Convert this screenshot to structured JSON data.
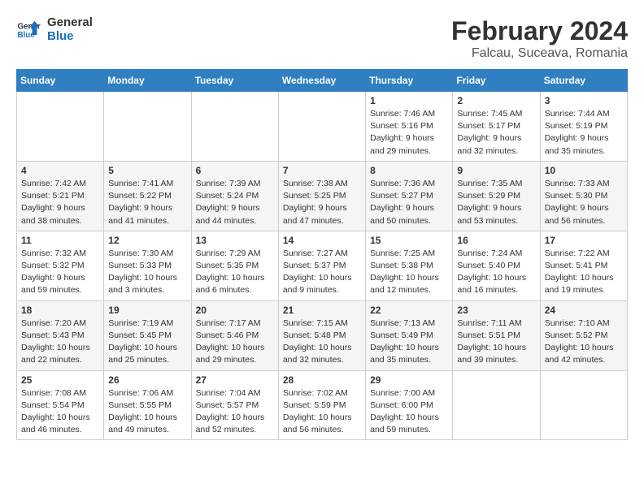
{
  "header": {
    "logo_line1": "General",
    "logo_line2": "Blue",
    "title": "February 2024",
    "subtitle": "Falcau, Suceava, Romania"
  },
  "weekdays": [
    "Sunday",
    "Monday",
    "Tuesday",
    "Wednesday",
    "Thursday",
    "Friday",
    "Saturday"
  ],
  "weeks": [
    [
      {
        "day": "",
        "sunrise": "",
        "sunset": "",
        "daylight": ""
      },
      {
        "day": "",
        "sunrise": "",
        "sunset": "",
        "daylight": ""
      },
      {
        "day": "",
        "sunrise": "",
        "sunset": "",
        "daylight": ""
      },
      {
        "day": "",
        "sunrise": "",
        "sunset": "",
        "daylight": ""
      },
      {
        "day": "1",
        "sunrise": "Sunrise: 7:46 AM",
        "sunset": "Sunset: 5:16 PM",
        "daylight": "Daylight: 9 hours and 29 minutes."
      },
      {
        "day": "2",
        "sunrise": "Sunrise: 7:45 AM",
        "sunset": "Sunset: 5:17 PM",
        "daylight": "Daylight: 9 hours and 32 minutes."
      },
      {
        "day": "3",
        "sunrise": "Sunrise: 7:44 AM",
        "sunset": "Sunset: 5:19 PM",
        "daylight": "Daylight: 9 hours and 35 minutes."
      }
    ],
    [
      {
        "day": "4",
        "sunrise": "Sunrise: 7:42 AM",
        "sunset": "Sunset: 5:21 PM",
        "daylight": "Daylight: 9 hours and 38 minutes."
      },
      {
        "day": "5",
        "sunrise": "Sunrise: 7:41 AM",
        "sunset": "Sunset: 5:22 PM",
        "daylight": "Daylight: 9 hours and 41 minutes."
      },
      {
        "day": "6",
        "sunrise": "Sunrise: 7:39 AM",
        "sunset": "Sunset: 5:24 PM",
        "daylight": "Daylight: 9 hours and 44 minutes."
      },
      {
        "day": "7",
        "sunrise": "Sunrise: 7:38 AM",
        "sunset": "Sunset: 5:25 PM",
        "daylight": "Daylight: 9 hours and 47 minutes."
      },
      {
        "day": "8",
        "sunrise": "Sunrise: 7:36 AM",
        "sunset": "Sunset: 5:27 PM",
        "daylight": "Daylight: 9 hours and 50 minutes."
      },
      {
        "day": "9",
        "sunrise": "Sunrise: 7:35 AM",
        "sunset": "Sunset: 5:29 PM",
        "daylight": "Daylight: 9 hours and 53 minutes."
      },
      {
        "day": "10",
        "sunrise": "Sunrise: 7:33 AM",
        "sunset": "Sunset: 5:30 PM",
        "daylight": "Daylight: 9 hours and 56 minutes."
      }
    ],
    [
      {
        "day": "11",
        "sunrise": "Sunrise: 7:32 AM",
        "sunset": "Sunset: 5:32 PM",
        "daylight": "Daylight: 9 hours and 59 minutes."
      },
      {
        "day": "12",
        "sunrise": "Sunrise: 7:30 AM",
        "sunset": "Sunset: 5:33 PM",
        "daylight": "Daylight: 10 hours and 3 minutes."
      },
      {
        "day": "13",
        "sunrise": "Sunrise: 7:29 AM",
        "sunset": "Sunset: 5:35 PM",
        "daylight": "Daylight: 10 hours and 6 minutes."
      },
      {
        "day": "14",
        "sunrise": "Sunrise: 7:27 AM",
        "sunset": "Sunset: 5:37 PM",
        "daylight": "Daylight: 10 hours and 9 minutes."
      },
      {
        "day": "15",
        "sunrise": "Sunrise: 7:25 AM",
        "sunset": "Sunset: 5:38 PM",
        "daylight": "Daylight: 10 hours and 12 minutes."
      },
      {
        "day": "16",
        "sunrise": "Sunrise: 7:24 AM",
        "sunset": "Sunset: 5:40 PM",
        "daylight": "Daylight: 10 hours and 16 minutes."
      },
      {
        "day": "17",
        "sunrise": "Sunrise: 7:22 AM",
        "sunset": "Sunset: 5:41 PM",
        "daylight": "Daylight: 10 hours and 19 minutes."
      }
    ],
    [
      {
        "day": "18",
        "sunrise": "Sunrise: 7:20 AM",
        "sunset": "Sunset: 5:43 PM",
        "daylight": "Daylight: 10 hours and 22 minutes."
      },
      {
        "day": "19",
        "sunrise": "Sunrise: 7:19 AM",
        "sunset": "Sunset: 5:45 PM",
        "daylight": "Daylight: 10 hours and 25 minutes."
      },
      {
        "day": "20",
        "sunrise": "Sunrise: 7:17 AM",
        "sunset": "Sunset: 5:46 PM",
        "daylight": "Daylight: 10 hours and 29 minutes."
      },
      {
        "day": "21",
        "sunrise": "Sunrise: 7:15 AM",
        "sunset": "Sunset: 5:48 PM",
        "daylight": "Daylight: 10 hours and 32 minutes."
      },
      {
        "day": "22",
        "sunrise": "Sunrise: 7:13 AM",
        "sunset": "Sunset: 5:49 PM",
        "daylight": "Daylight: 10 hours and 35 minutes."
      },
      {
        "day": "23",
        "sunrise": "Sunrise: 7:11 AM",
        "sunset": "Sunset: 5:51 PM",
        "daylight": "Daylight: 10 hours and 39 minutes."
      },
      {
        "day": "24",
        "sunrise": "Sunrise: 7:10 AM",
        "sunset": "Sunset: 5:52 PM",
        "daylight": "Daylight: 10 hours and 42 minutes."
      }
    ],
    [
      {
        "day": "25",
        "sunrise": "Sunrise: 7:08 AM",
        "sunset": "Sunset: 5:54 PM",
        "daylight": "Daylight: 10 hours and 46 minutes."
      },
      {
        "day": "26",
        "sunrise": "Sunrise: 7:06 AM",
        "sunset": "Sunset: 5:55 PM",
        "daylight": "Daylight: 10 hours and 49 minutes."
      },
      {
        "day": "27",
        "sunrise": "Sunrise: 7:04 AM",
        "sunset": "Sunset: 5:57 PM",
        "daylight": "Daylight: 10 hours and 52 minutes."
      },
      {
        "day": "28",
        "sunrise": "Sunrise: 7:02 AM",
        "sunset": "Sunset: 5:59 PM",
        "daylight": "Daylight: 10 hours and 56 minutes."
      },
      {
        "day": "29",
        "sunrise": "Sunrise: 7:00 AM",
        "sunset": "Sunset: 6:00 PM",
        "daylight": "Daylight: 10 hours and 59 minutes."
      },
      {
        "day": "",
        "sunrise": "",
        "sunset": "",
        "daylight": ""
      },
      {
        "day": "",
        "sunrise": "",
        "sunset": "",
        "daylight": ""
      }
    ]
  ]
}
